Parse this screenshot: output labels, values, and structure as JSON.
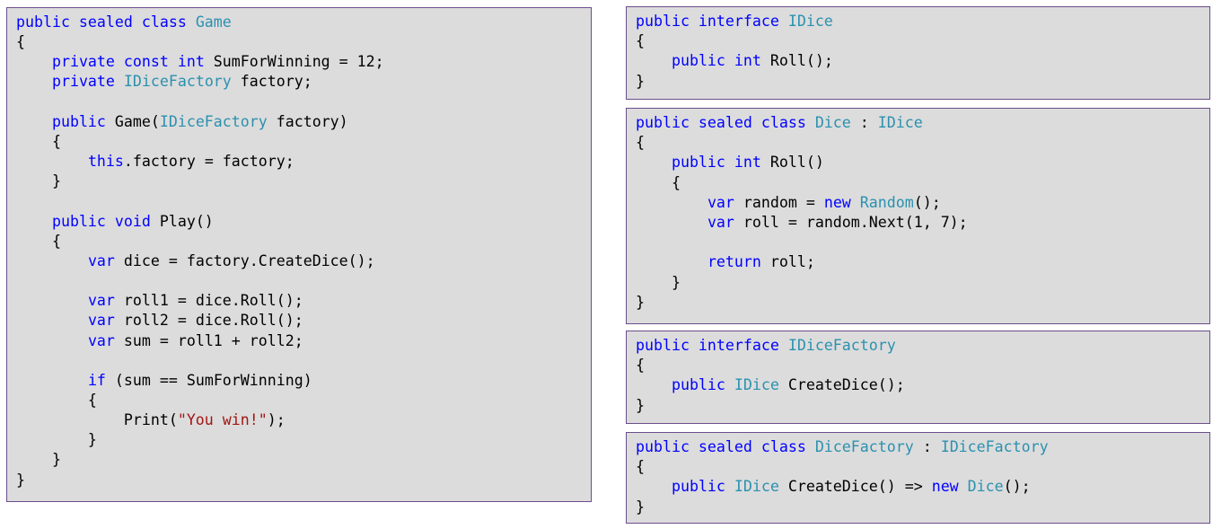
{
  "colors": {
    "background": "#dcdcdc",
    "border": "#6b4e8c",
    "keyword": "#0000ff",
    "type": "#2b91af",
    "string": "#a31515",
    "plain": "#000000"
  },
  "snippets": [
    {
      "name": "game-class-code",
      "lines": [
        [
          {
            "k": "kw",
            "t": "public sealed class "
          },
          {
            "k": "ty",
            "t": "Game"
          }
        ],
        [
          {
            "k": "pl",
            "t": "{"
          }
        ],
        [
          {
            "k": "pl",
            "t": "    "
          },
          {
            "k": "kw",
            "t": "private const int "
          },
          {
            "k": "pl",
            "t": "SumForWinning = 12;"
          }
        ],
        [
          {
            "k": "pl",
            "t": "    "
          },
          {
            "k": "kw",
            "t": "private "
          },
          {
            "k": "ty",
            "t": "IDiceFactory"
          },
          {
            "k": "pl",
            "t": " factory;"
          }
        ],
        [
          {
            "k": "pl",
            "t": ""
          }
        ],
        [
          {
            "k": "pl",
            "t": "    "
          },
          {
            "k": "kw",
            "t": "public "
          },
          {
            "k": "pl",
            "t": "Game("
          },
          {
            "k": "ty",
            "t": "IDiceFactory"
          },
          {
            "k": "pl",
            "t": " factory)"
          }
        ],
        [
          {
            "k": "pl",
            "t": "    {"
          }
        ],
        [
          {
            "k": "pl",
            "t": "        "
          },
          {
            "k": "kw",
            "t": "this"
          },
          {
            "k": "pl",
            "t": ".factory = factory;"
          }
        ],
        [
          {
            "k": "pl",
            "t": "    }"
          }
        ],
        [
          {
            "k": "pl",
            "t": ""
          }
        ],
        [
          {
            "k": "pl",
            "t": "    "
          },
          {
            "k": "kw",
            "t": "public void "
          },
          {
            "k": "pl",
            "t": "Play()"
          }
        ],
        [
          {
            "k": "pl",
            "t": "    {"
          }
        ],
        [
          {
            "k": "pl",
            "t": "        "
          },
          {
            "k": "kw",
            "t": "var "
          },
          {
            "k": "pl",
            "t": "dice = factory.CreateDice();"
          }
        ],
        [
          {
            "k": "pl",
            "t": ""
          }
        ],
        [
          {
            "k": "pl",
            "t": "        "
          },
          {
            "k": "kw",
            "t": "var "
          },
          {
            "k": "pl",
            "t": "roll1 = dice.Roll();"
          }
        ],
        [
          {
            "k": "pl",
            "t": "        "
          },
          {
            "k": "kw",
            "t": "var "
          },
          {
            "k": "pl",
            "t": "roll2 = dice.Roll();"
          }
        ],
        [
          {
            "k": "pl",
            "t": "        "
          },
          {
            "k": "kw",
            "t": "var "
          },
          {
            "k": "pl",
            "t": "sum = roll1 + roll2;"
          }
        ],
        [
          {
            "k": "pl",
            "t": ""
          }
        ],
        [
          {
            "k": "pl",
            "t": "        "
          },
          {
            "k": "kw",
            "t": "if "
          },
          {
            "k": "pl",
            "t": "(sum == SumForWinning)"
          }
        ],
        [
          {
            "k": "pl",
            "t": "        {"
          }
        ],
        [
          {
            "k": "pl",
            "t": "            Print("
          },
          {
            "k": "st",
            "t": "\"You win!\""
          },
          {
            "k": "pl",
            "t": ");"
          }
        ],
        [
          {
            "k": "pl",
            "t": "        }"
          }
        ],
        [
          {
            "k": "pl",
            "t": "    }"
          }
        ],
        [
          {
            "k": "pl",
            "t": "}"
          }
        ]
      ]
    },
    {
      "name": "idice-interface-code",
      "lines": [
        [
          {
            "k": "kw",
            "t": "public interface "
          },
          {
            "k": "ty",
            "t": "IDice"
          }
        ],
        [
          {
            "k": "pl",
            "t": "{"
          }
        ],
        [
          {
            "k": "pl",
            "t": "    "
          },
          {
            "k": "kw",
            "t": "public int "
          },
          {
            "k": "pl",
            "t": "Roll();"
          }
        ],
        [
          {
            "k": "pl",
            "t": "}"
          }
        ]
      ]
    },
    {
      "name": "dice-class-code",
      "lines": [
        [
          {
            "k": "kw",
            "t": "public sealed class "
          },
          {
            "k": "ty",
            "t": "Dice"
          },
          {
            "k": "pl",
            "t": " : "
          },
          {
            "k": "ty",
            "t": "IDice"
          }
        ],
        [
          {
            "k": "pl",
            "t": "{"
          }
        ],
        [
          {
            "k": "pl",
            "t": "    "
          },
          {
            "k": "kw",
            "t": "public int "
          },
          {
            "k": "pl",
            "t": "Roll()"
          }
        ],
        [
          {
            "k": "pl",
            "t": "    {"
          }
        ],
        [
          {
            "k": "pl",
            "t": "        "
          },
          {
            "k": "kw",
            "t": "var "
          },
          {
            "k": "pl",
            "t": "random = "
          },
          {
            "k": "kw",
            "t": "new "
          },
          {
            "k": "ty",
            "t": "Random"
          },
          {
            "k": "pl",
            "t": "();"
          }
        ],
        [
          {
            "k": "pl",
            "t": "        "
          },
          {
            "k": "kw",
            "t": "var "
          },
          {
            "k": "pl",
            "t": "roll = random.Next(1, 7);"
          }
        ],
        [
          {
            "k": "pl",
            "t": ""
          }
        ],
        [
          {
            "k": "pl",
            "t": "        "
          },
          {
            "k": "kw",
            "t": "return "
          },
          {
            "k": "pl",
            "t": "roll;"
          }
        ],
        [
          {
            "k": "pl",
            "t": "    }"
          }
        ],
        [
          {
            "k": "pl",
            "t": "}"
          }
        ]
      ]
    },
    {
      "name": "idicefactory-interface-code",
      "lines": [
        [
          {
            "k": "kw",
            "t": "public interface "
          },
          {
            "k": "ty",
            "t": "IDiceFactory"
          }
        ],
        [
          {
            "k": "pl",
            "t": "{"
          }
        ],
        [
          {
            "k": "pl",
            "t": "    "
          },
          {
            "k": "kw",
            "t": "public "
          },
          {
            "k": "ty",
            "t": "IDice"
          },
          {
            "k": "pl",
            "t": " CreateDice();"
          }
        ],
        [
          {
            "k": "pl",
            "t": "}"
          }
        ]
      ]
    },
    {
      "name": "dicefactory-class-code",
      "lines": [
        [
          {
            "k": "kw",
            "t": "public sealed class "
          },
          {
            "k": "ty",
            "t": "DiceFactory"
          },
          {
            "k": "pl",
            "t": " : "
          },
          {
            "k": "ty",
            "t": "IDiceFactory"
          }
        ],
        [
          {
            "k": "pl",
            "t": "{"
          }
        ],
        [
          {
            "k": "pl",
            "t": "    "
          },
          {
            "k": "kw",
            "t": "public "
          },
          {
            "k": "ty",
            "t": "IDice"
          },
          {
            "k": "pl",
            "t": " CreateDice() => "
          },
          {
            "k": "kw",
            "t": "new "
          },
          {
            "k": "ty",
            "t": "Dice"
          },
          {
            "k": "pl",
            "t": "();"
          }
        ],
        [
          {
            "k": "pl",
            "t": "}"
          }
        ]
      ]
    }
  ]
}
